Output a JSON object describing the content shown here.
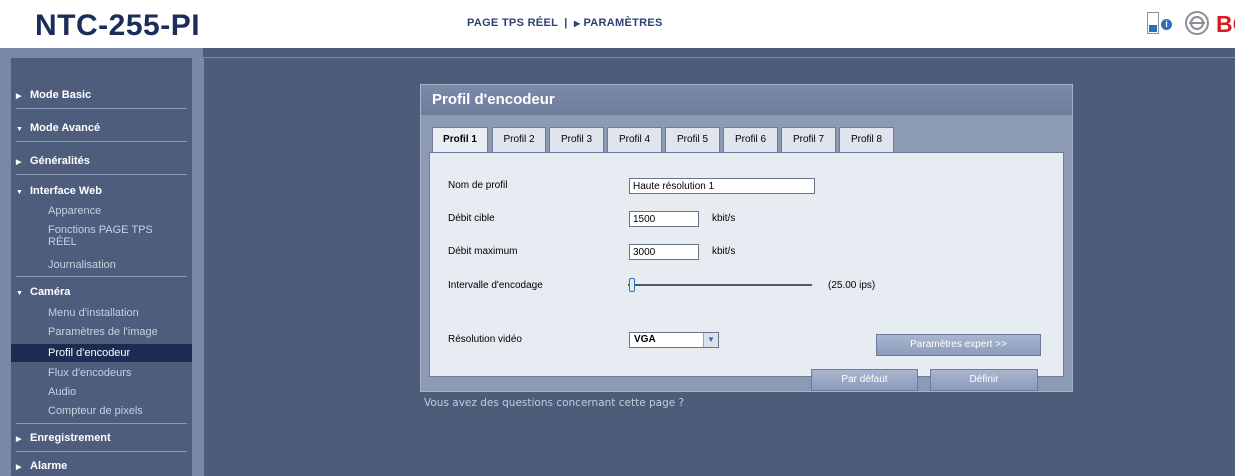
{
  "header": {
    "title": "NTC-255-PI",
    "nav": {
      "live_label": "PAGE TPS RÉEL",
      "separator": "|",
      "settings_label": "PARAMÈTRES"
    },
    "info_icon_glyph": "i",
    "brand_text": "BO"
  },
  "sidebar": {
    "mode_basic": "Mode Basic",
    "mode_advanced": "Mode Avancé",
    "general": "Généralités",
    "web_interface": {
      "label": "Interface Web",
      "items": [
        "Apparence",
        "Fonctions PAGE TPS RÉEL",
        "Journalisation"
      ]
    },
    "camera": {
      "label": "Caméra",
      "items": [
        "Menu d'installation",
        "Paramètres de l'image",
        "Profil d'encodeur",
        "Flux d'encodeurs",
        "Audio",
        "Compteur de pixels"
      ],
      "active_index": 2
    },
    "recording": "Enregistrement",
    "alarm": "Alarme"
  },
  "panel": {
    "title": "Profil d'encodeur",
    "tabs": [
      "Profil 1",
      "Profil 2",
      "Profil 3",
      "Profil 4",
      "Profil 5",
      "Profil 6",
      "Profil 7",
      "Profil 8"
    ],
    "active_tab": 0,
    "form": {
      "profile_name_label": "Nom de profil",
      "profile_name_value": "Haute résolution 1",
      "target_rate_label": "Débit cible",
      "target_rate_value": "1500",
      "target_rate_unit": "kbit/s",
      "max_rate_label": "Débit maximum",
      "max_rate_value": "3000",
      "max_rate_unit": "kbit/s",
      "interval_label": "Intervalle d'encodage",
      "interval_value": "(25.00 ips)",
      "resolution_label": "Résolution vidéo",
      "resolution_value": "VGA"
    },
    "buttons": {
      "expert": "Paramètres expert >>",
      "default": "Par défaut",
      "set": "Définir"
    }
  },
  "help_text": "Vous avez des questions concernant cette page ?",
  "colors": {
    "background": "#4c5c79",
    "header_title": "#1b2d5a",
    "brand_red": "#d41d24",
    "active_nav": "#1b2b52",
    "panel": "#8d9ab4"
  },
  "icons": {
    "device_status": "device-status-icon",
    "info": "info-icon",
    "brand_logo": "brand-logo-icon"
  }
}
